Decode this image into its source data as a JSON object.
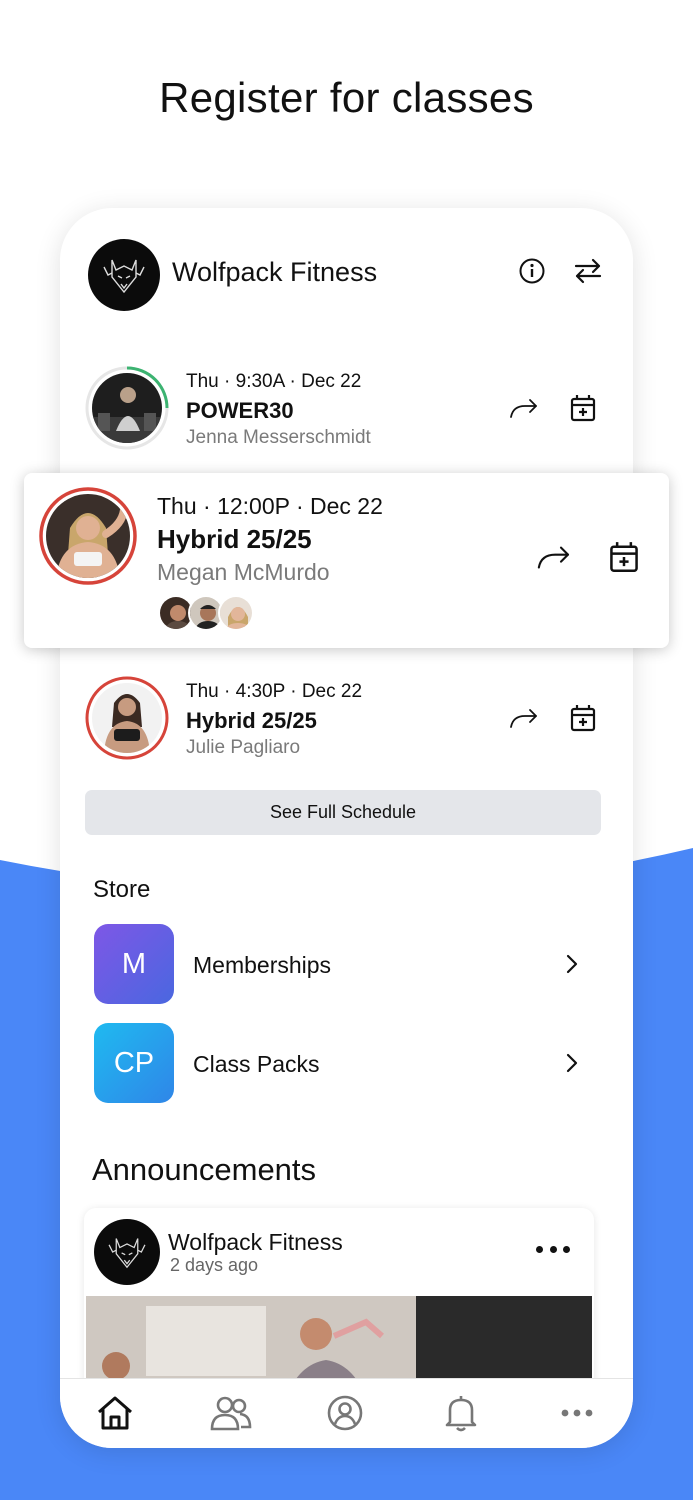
{
  "headline": "Register for classes",
  "colors": {
    "accent_blue": "#4a87f7",
    "ring_red": "#d6443a",
    "ring_green": "#3cb371"
  },
  "gym": {
    "name": "Wolfpack Fitness",
    "info_icon": "info-icon",
    "switch_icon": "switch-arrows-icon"
  },
  "classes": [
    {
      "time": "Thu · 9:30A · Dec 22",
      "name": "POWER30",
      "coach": "Jenna Messerschmidt"
    },
    {
      "time": "Thu · 12:00P · Dec 22",
      "name": "Hybrid 25/25",
      "coach": "Megan McMurdo"
    },
    {
      "time": "Thu · 4:30P · Dec 22",
      "name": "Hybrid 25/25",
      "coach": "Julie  Pagliaro"
    }
  ],
  "see_full_schedule": "See Full Schedule",
  "store": {
    "title": "Store",
    "items": [
      {
        "initials": "M",
        "label": "Memberships"
      },
      {
        "initials": "CP",
        "label": "Class Packs"
      }
    ]
  },
  "announcements": {
    "title": "Announcements",
    "post": {
      "author": "Wolfpack Fitness",
      "time": "2 days ago"
    }
  },
  "tabbar": [
    "home-icon",
    "community-icon",
    "profile-icon",
    "notifications-icon",
    "more-icon"
  ]
}
